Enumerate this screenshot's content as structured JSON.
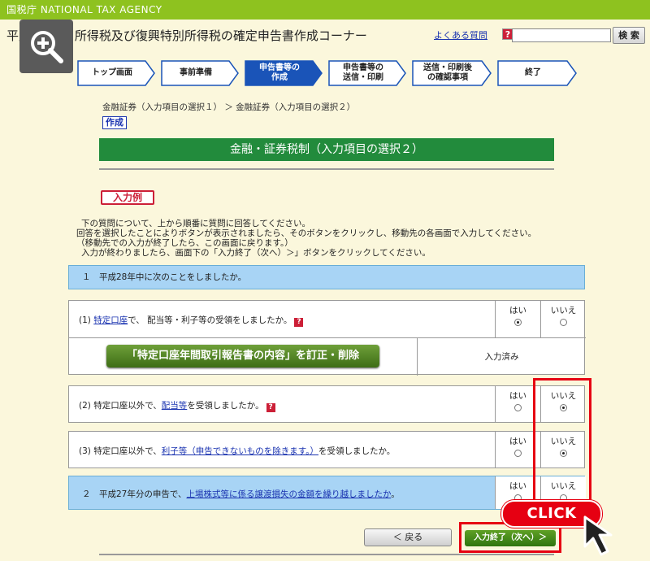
{
  "topbar": {
    "agency": "国税庁  NATIONAL TAX AGENCY"
  },
  "header": {
    "title": "平成28年分 所得税及び復興特別所得税の確定申告書作成コーナー",
    "faq_label": "よくある質問",
    "faq_icon": "?",
    "search_button": "検 索"
  },
  "steps": [
    {
      "label": "トップ画面"
    },
    {
      "label": "事前準備"
    },
    {
      "label": "申告書等の\n作成"
    },
    {
      "label": "申告書等の\n送信・印刷"
    },
    {
      "label": "送信・印刷後\nの確認事項"
    },
    {
      "label": "終了"
    }
  ],
  "breadcrumb": "金融証券（入力項目の選択１） ＞ 金融証券（入力項目の選択２）",
  "sakusei": "作成",
  "section_title": "金融・証券税制（入力項目の選択２）",
  "example_button": "入力例",
  "instructions": [
    "下の質問について、上から順番に質問に回答してください。",
    "回答を選択したことによりボタンが表示されましたら、そのボタンをクリックし、移動先の各画面で入力してください。",
    "（移動先での入力が終了したら、この画面に戻ります。）",
    "入力が終わりましたら、画面下の「入力終了（次へ）＞」ボタンをクリックしてください。"
  ],
  "question1": {
    "header": "１　平成28年中に次のことをしましたか。"
  },
  "q1a": {
    "prefix": "(1) ",
    "link": "特定口座",
    "suffix": "で、 配当等・利子等の受領をしましたか。",
    "yes": "はい",
    "no": "いいえ",
    "selected": "yes",
    "action_button": "「特定口座年間取引報告書の内容」を訂正・削除",
    "status": "入力済み"
  },
  "q1b": {
    "prefix": "(2) 特定口座以外で、",
    "link": "配当等",
    "suffix": "を受領しましたか。",
    "yes": "はい",
    "no": "いいえ",
    "selected": "no"
  },
  "q1c": {
    "prefix": "(3) 特定口座以外で、",
    "link": "利子等（申告できないものを除きます。）",
    "suffix": "を受領しましたか。",
    "yes": "はい",
    "no": "いいえ",
    "selected": "no"
  },
  "question2": {
    "prefix": "２　平成27年分の申告で、",
    "link": "上場株式等に係る譲渡損失の金額を繰り越しましたか",
    "suffix": "。",
    "yes": "はい",
    "no": "いいえ"
  },
  "buttons": {
    "back": "＜ 戻る",
    "next": "入力終了（次へ）＞"
  },
  "annotation": {
    "click": "CLICK"
  },
  "colors": {
    "topbar": "#8ec21f",
    "section": "#228b3c",
    "accent_red": "#e60012",
    "step_active": "#1a54b8"
  }
}
